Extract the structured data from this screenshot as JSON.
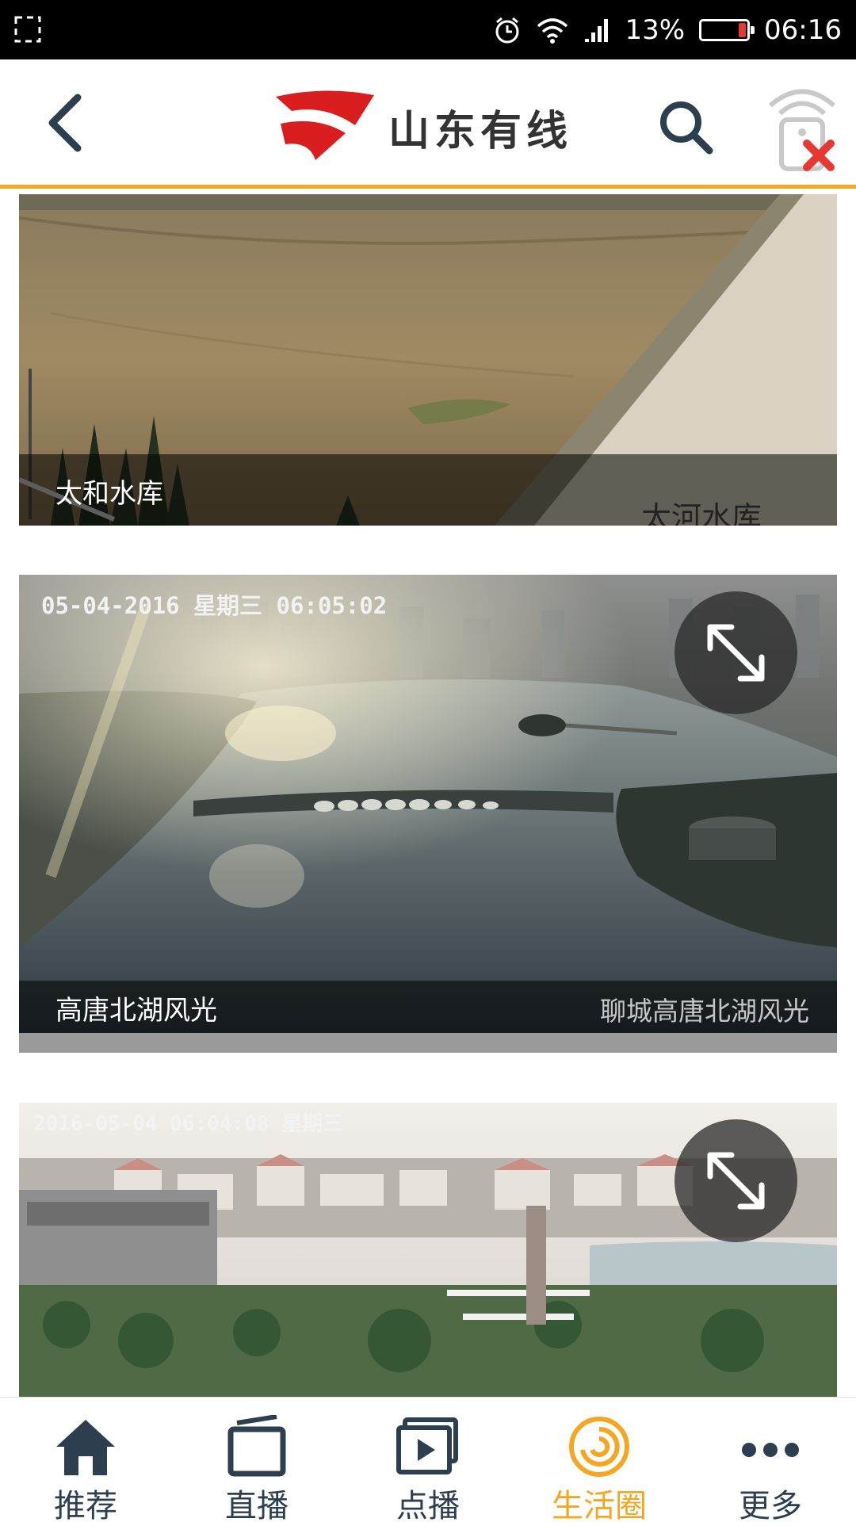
{
  "status_bar": {
    "battery_percent": "13%",
    "time": "06:16"
  },
  "header": {
    "brand": "山东有线",
    "accent_color": "#f5a623",
    "brand_red": "#d81e1e"
  },
  "cards": [
    {
      "title": "太和水库",
      "watermark": "太河水库"
    },
    {
      "title": "高唐北湖风光",
      "timestamp_overlay": "05-04-2016 星期三 06:05:02",
      "watermark": "聊城高唐北湖风光"
    },
    {
      "timestamp_overlay": "2016-05-04 06:04:08 星期三"
    }
  ],
  "bottom_nav": {
    "items": [
      {
        "label": "推荐",
        "icon": "home-icon"
      },
      {
        "label": "直播",
        "icon": "tv-icon"
      },
      {
        "label": "点播",
        "icon": "play-icon"
      },
      {
        "label": "生活圈",
        "icon": "circle-swirl-icon",
        "active": true
      },
      {
        "label": "更多",
        "icon": "more-dots-icon"
      }
    ]
  }
}
